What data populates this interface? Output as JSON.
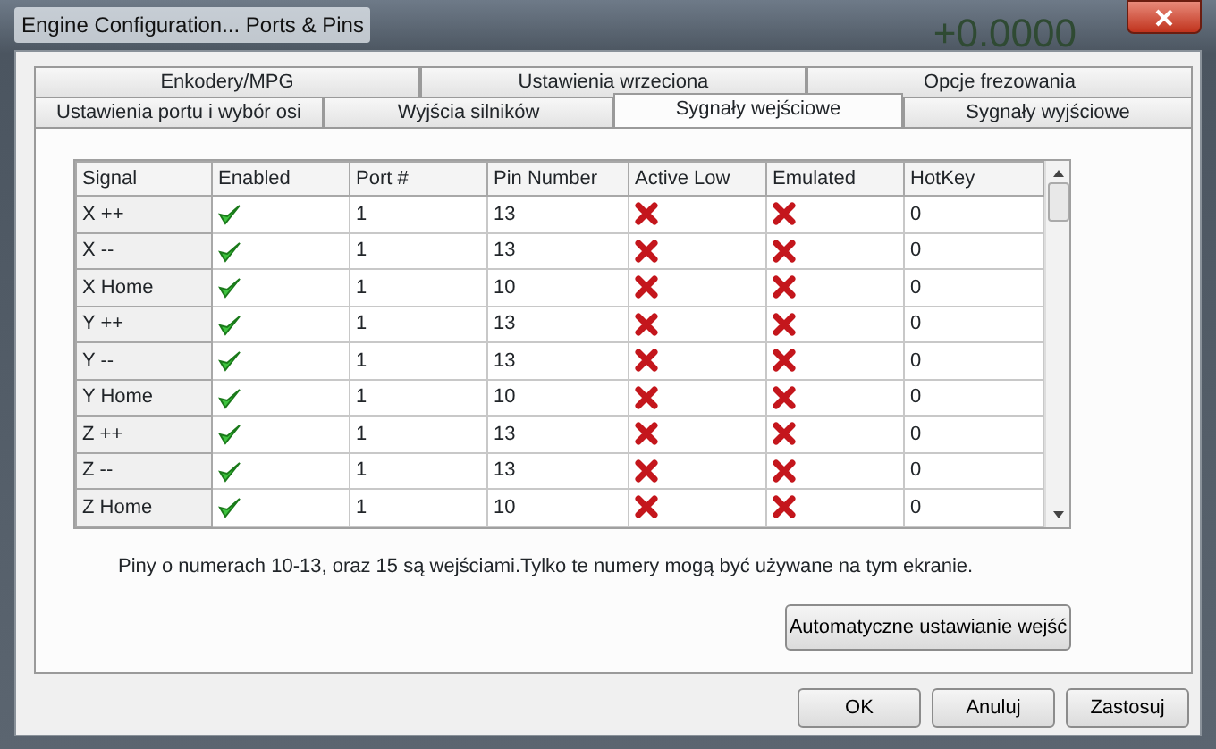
{
  "window": {
    "title": "Engine Configuration... Ports & Pins",
    "background_readout": "+0.0000"
  },
  "tab_rows": [
    [
      {
        "label": "Enkodery/MPG",
        "selected": false
      },
      {
        "label": "Ustawienia wrzeciona",
        "selected": false
      },
      {
        "label": "Opcje frezowania",
        "selected": false
      }
    ],
    [
      {
        "label": "Ustawienia portu i wybór osi",
        "selected": false
      },
      {
        "label": "Wyjścia silników",
        "selected": false
      },
      {
        "label": "Sygnały wejściowe",
        "selected": true
      },
      {
        "label": "Sygnały wyjściowe",
        "selected": false
      }
    ]
  ],
  "table": {
    "columns": [
      "Signal",
      "Enabled",
      "Port #",
      "Pin Number",
      "Active Low",
      "Emulated",
      "HotKey"
    ],
    "rows": [
      {
        "signal": "X ++",
        "enabled": true,
        "port": "1",
        "pin": "13",
        "active_low": false,
        "emulated": false,
        "hotkey": "0"
      },
      {
        "signal": "X --",
        "enabled": true,
        "port": "1",
        "pin": "13",
        "active_low": false,
        "emulated": false,
        "hotkey": "0"
      },
      {
        "signal": "X Home",
        "enabled": true,
        "port": "1",
        "pin": "10",
        "active_low": false,
        "emulated": false,
        "hotkey": "0"
      },
      {
        "signal": "Y ++",
        "enabled": true,
        "port": "1",
        "pin": "13",
        "active_low": false,
        "emulated": false,
        "hotkey": "0"
      },
      {
        "signal": "Y --",
        "enabled": true,
        "port": "1",
        "pin": "13",
        "active_low": false,
        "emulated": false,
        "hotkey": "0"
      },
      {
        "signal": "Y Home",
        "enabled": true,
        "port": "1",
        "pin": "10",
        "active_low": false,
        "emulated": false,
        "hotkey": "0"
      },
      {
        "signal": "Z ++",
        "enabled": true,
        "port": "1",
        "pin": "13",
        "active_low": false,
        "emulated": false,
        "hotkey": "0"
      },
      {
        "signal": "Z --",
        "enabled": true,
        "port": "1",
        "pin": "13",
        "active_low": false,
        "emulated": false,
        "hotkey": "0"
      },
      {
        "signal": "Z Home",
        "enabled": true,
        "port": "1",
        "pin": "10",
        "active_low": false,
        "emulated": false,
        "hotkey": "0"
      }
    ]
  },
  "note": "Piny o numerach 10-13, oraz 15 są wejściami.Tylko te numery mogą być używane na tym ekranie.",
  "auto_button": "Automatyczne ustawianie wejść",
  "buttons": [
    "OK",
    "Anuluj",
    "Zastosuj"
  ]
}
